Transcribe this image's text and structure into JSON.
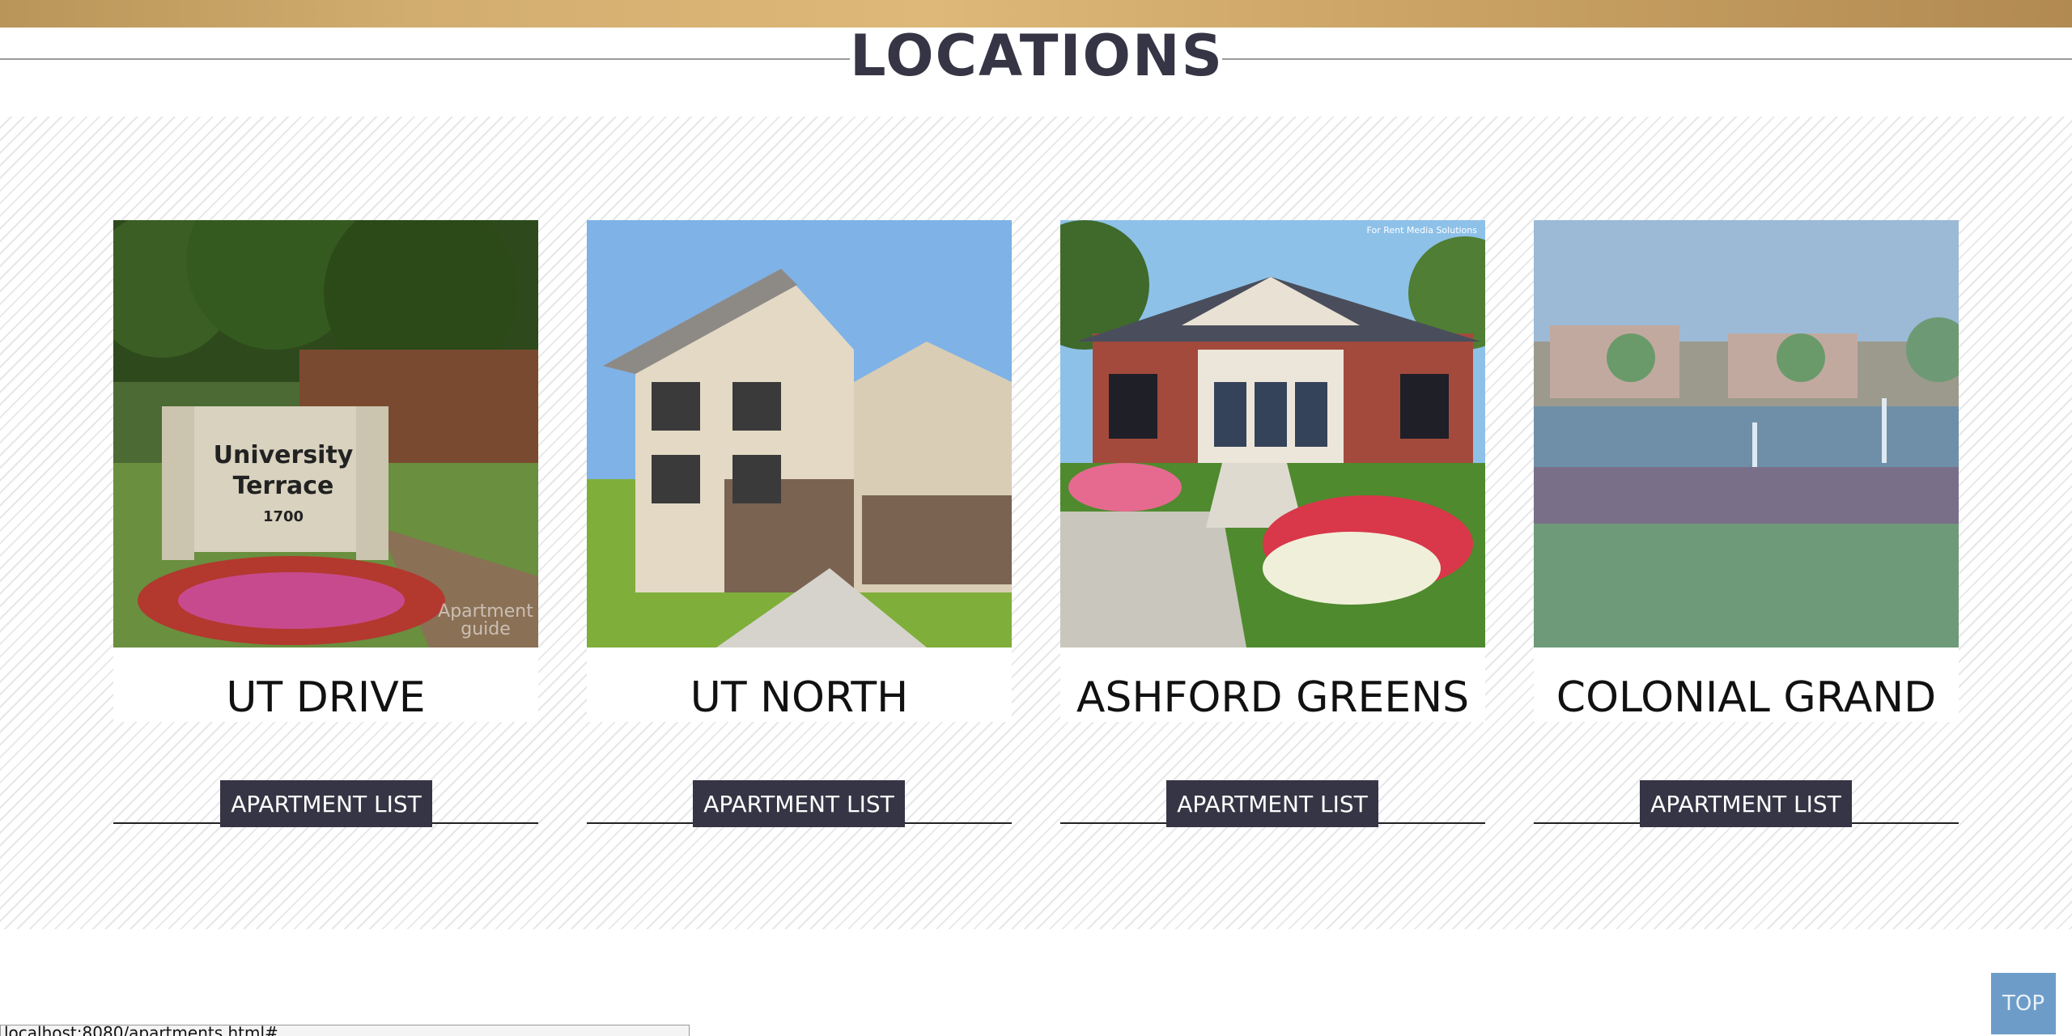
{
  "page": {
    "heading": "LOCATIONS",
    "accent_color": "#363545",
    "gold_color": "#d2ad70"
  },
  "locations": [
    {
      "name": "UT DRIVE",
      "button_label": "APARTMENT LIST",
      "image": "university-terrace-sign-photo"
    },
    {
      "name": "UT NORTH",
      "button_label": "APARTMENT LIST",
      "image": "apartment-building-photo"
    },
    {
      "name": "ASHFORD GREENS",
      "button_label": "APARTMENT LIST",
      "image": "clubhouse-photo"
    },
    {
      "name": "COLONIAL GRAND",
      "button_label": "APARTMENT LIST",
      "image": "pond-with-fountains-photo"
    }
  ],
  "photo_text": {
    "sign_line1": "University",
    "sign_line2": "Terrace",
    "sign_number": "1700",
    "watermark1_line1": "Apartment",
    "watermark1_line2": "guide",
    "watermark3": "For Rent Media Solutions"
  },
  "top_button": {
    "label": "TOP"
  },
  "status_bar": {
    "url": "localhost:8080/apartments.html#"
  }
}
